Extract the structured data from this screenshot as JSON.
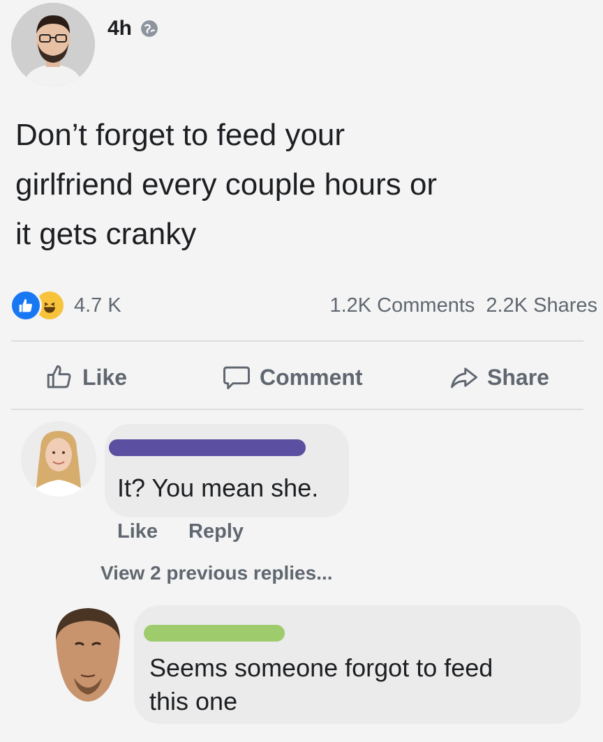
{
  "post": {
    "time": "4h",
    "privacy_icon": "globe-icon",
    "text_lines": [
      "Don’t forget to feed your",
      "girlfriend every couple hours or",
      "it gets cranky"
    ]
  },
  "stats": {
    "reactions": [
      "like-reaction-icon",
      "haha-reaction-icon"
    ],
    "reaction_count": "4.7 K",
    "comments": "1.2K Comments",
    "shares": "2.2K Shares"
  },
  "actions": {
    "like": "Like",
    "comment": "Comment",
    "share": "Share"
  },
  "comments": [
    {
      "text": "It? You mean she.",
      "like": "Like",
      "reply": "Reply",
      "redaction_color": "#5a4fa0"
    },
    {
      "text_lines": [
        "Seems someone forgot to feed",
        "this one"
      ],
      "redaction_color": "#9ecb6b"
    }
  ],
  "view_replies": "View 2 previous replies...",
  "colors": {
    "facebook_blue": "#1877f2",
    "haha_yellow": "#f7c33b",
    "secondary_text": "#606770"
  }
}
